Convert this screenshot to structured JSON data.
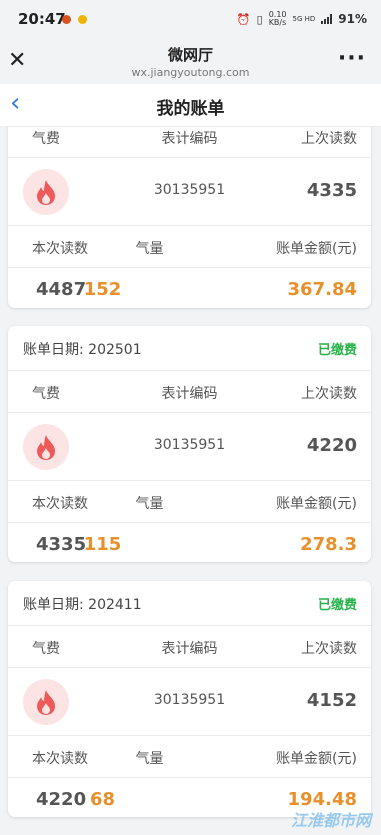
{
  "status_bar": {
    "time": "20:47",
    "net_speed": "0.10\nKB/s",
    "net_type": "5G HD",
    "battery": "91%"
  },
  "browser": {
    "title": "微网厅",
    "url": "wx.jiangyoutong.com"
  },
  "nav": {
    "title": "我的账单"
  },
  "labels": {
    "gas_fee": "气费",
    "meter_code": "表计编码",
    "prev_reading": "上次读数",
    "curr_reading": "本次读数",
    "gas_volume": "气量",
    "bill_amount": "账单金额(元)",
    "bill_date": "账单日期:"
  },
  "bills": [
    {
      "date": "",
      "status": "",
      "meter_code": "30135951",
      "prev_reading": "4335",
      "curr_reading": "4487",
      "gas_volume": "152",
      "amount": "367.84"
    },
    {
      "date": "202501",
      "status": "已缴费",
      "meter_code": "30135951",
      "prev_reading": "4220",
      "curr_reading": "4335",
      "gas_volume": "115",
      "amount": "278.3"
    },
    {
      "date": "202411",
      "status": "已缴费",
      "meter_code": "30135951",
      "prev_reading": "4152",
      "curr_reading": "4220",
      "gas_volume": "68",
      "amount": "194.48"
    }
  ],
  "watermark": "江淮都市网",
  "colors": {
    "accent": "#2f7ed8",
    "paid": "#27b34a",
    "amount": "#e8902c",
    "fire": "#ee5a5a"
  }
}
